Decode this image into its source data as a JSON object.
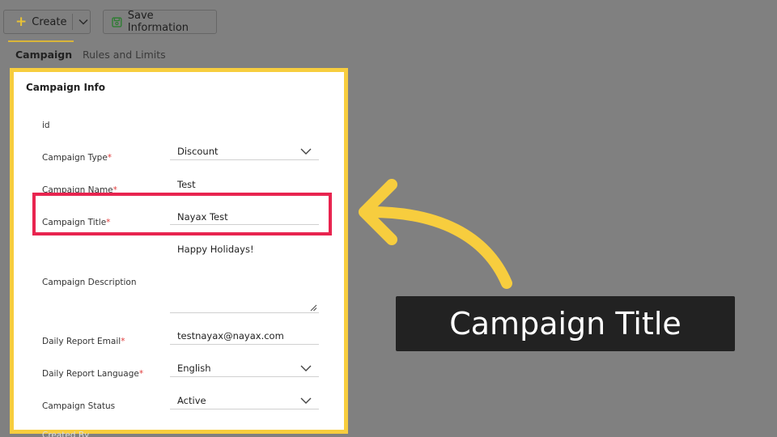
{
  "toolbar": {
    "create_label": "Create",
    "save_label": "Save Information"
  },
  "tabs": [
    {
      "label": "Campaign"
    },
    {
      "label": "Rules and Limits"
    }
  ],
  "panel": {
    "title": "Campaign Info",
    "fields": {
      "id": {
        "label": "id"
      },
      "type": {
        "label": "Campaign Type",
        "required": "*",
        "value": "Discount"
      },
      "name": {
        "label": "Campaign Name",
        "required": "*",
        "value": "Test"
      },
      "title": {
        "label": "Campaign Title",
        "required": "*",
        "value": "Nayax Test"
      },
      "description": {
        "label": "Campaign Description",
        "value": "Happy Holidays!"
      },
      "email": {
        "label": "Daily Report Email",
        "required": "*",
        "value": "testnayax@nayax.com"
      },
      "language": {
        "label": "Daily Report Language",
        "required": "*",
        "value": "English"
      },
      "status": {
        "label": "Campaign Status",
        "value": "Active"
      },
      "created_by": {
        "label": "Created By"
      }
    }
  },
  "callout": {
    "text": "Campaign Title"
  },
  "colors": {
    "panel_border": "#f7cd3e",
    "highlight_border": "#e8244f",
    "arrow": "#f7cd3e",
    "callout_bg": "#222222"
  }
}
